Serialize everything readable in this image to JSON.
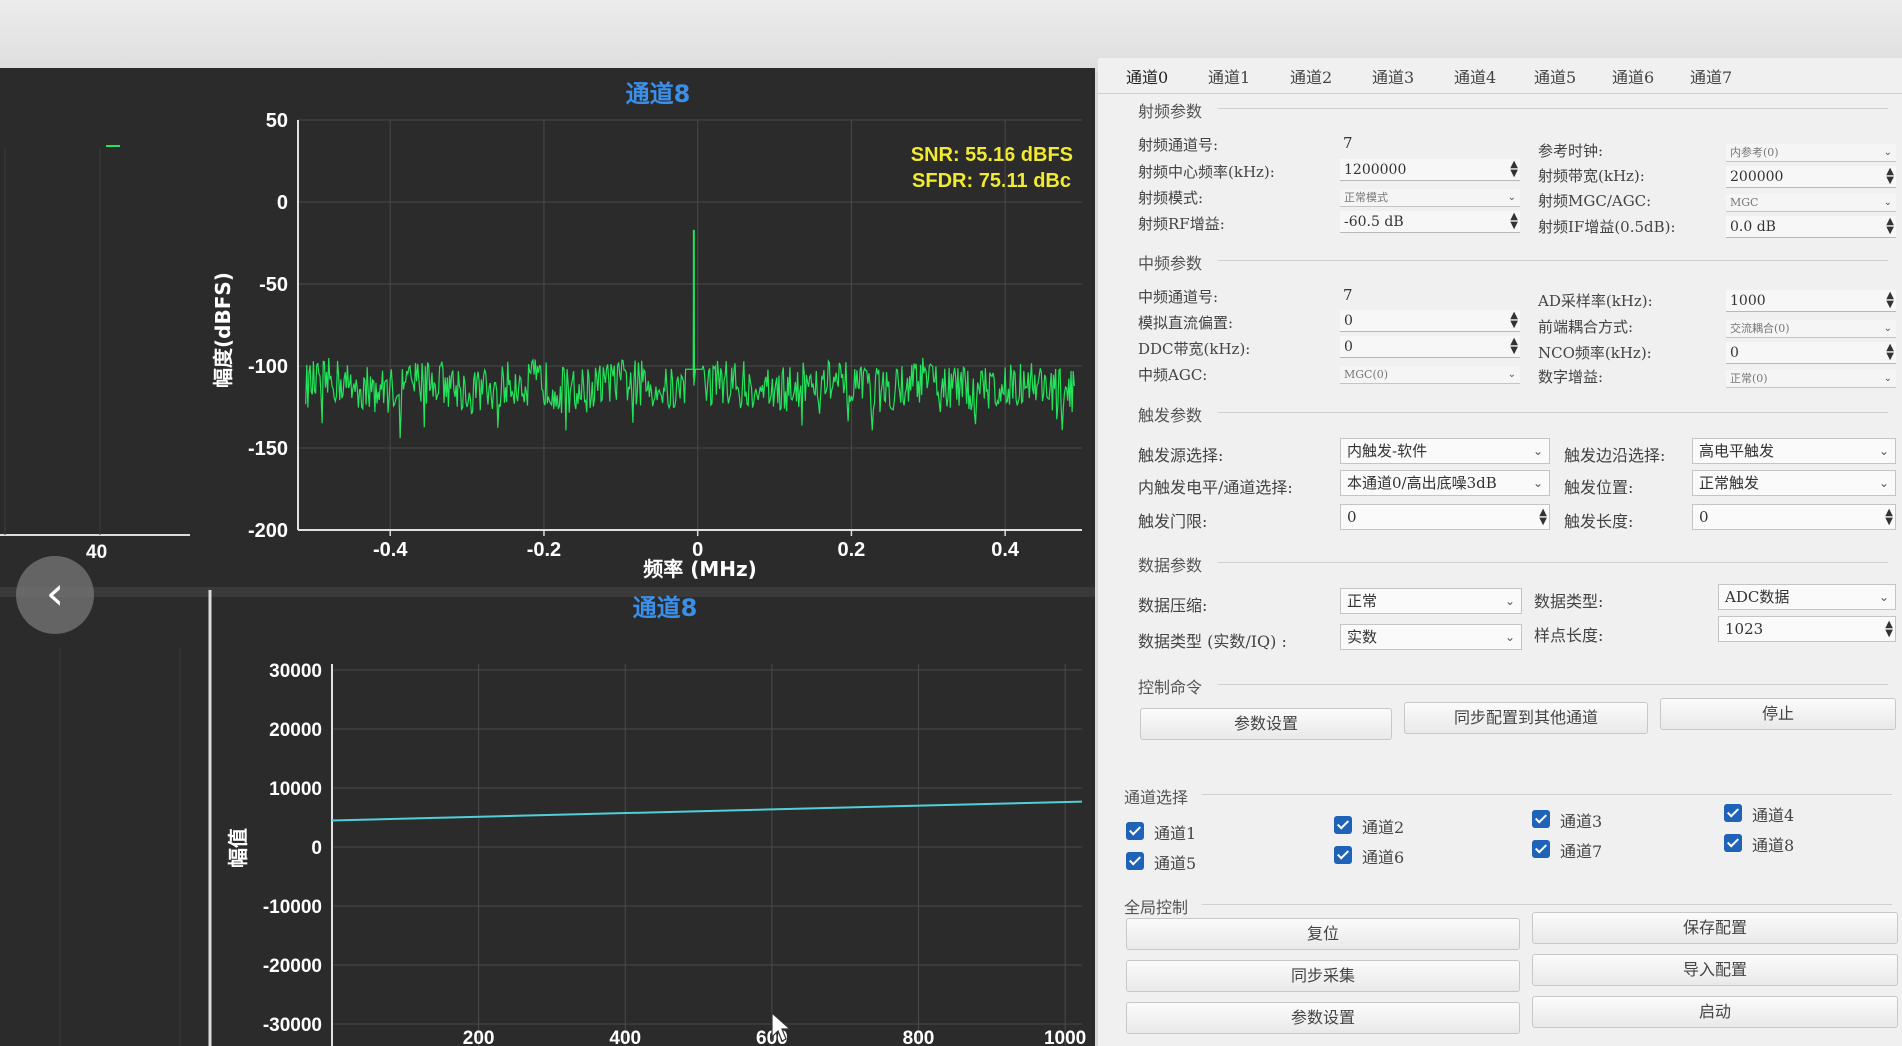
{
  "spectrum": {
    "title": "通道8",
    "snr": "SNR: 55.16 dBFS",
    "sfdr": "SFDR: 75.11 dBc",
    "ylabel": "幅度(dBFS)",
    "xlabel": "频率 (MHz)",
    "yticks": [
      "50",
      "0",
      "-50",
      "-100",
      "-150",
      "-200"
    ],
    "xticks": [
      "-0.4",
      "-0.2",
      "0",
      "0.2",
      "0.4"
    ],
    "trace_color": "#22e35a"
  },
  "left_partial": {
    "xtick": "40",
    "legend_color": "#22e35a"
  },
  "timedomain": {
    "title": "通道8",
    "ylabel": "幅值",
    "yticks": [
      "30000",
      "20000",
      "10000",
      "0",
      "-10000",
      "-20000",
      "-30000"
    ],
    "xticks": [
      "200",
      "400",
      "600",
      "800",
      "1000"
    ],
    "trace_color": "#4fd0d8"
  },
  "chart_data": [
    {
      "type": "line",
      "title": "通道8",
      "xlabel": "频率 (MHz)",
      "ylabel": "幅度(dBFS)",
      "xlim": [
        -0.52,
        0.5
      ],
      "ylim": [
        -200,
        50
      ],
      "grid": true,
      "annotations": [
        "SNR: 55.16 dBFS",
        "SFDR: 75.11 dBc"
      ],
      "series": [
        {
          "noise_floor": -112,
          "peak": {
            "x": -0.005,
            "y": -17
          },
          "x_range": [
            -0.51,
            0.49
          ]
        }
      ]
    },
    {
      "type": "line",
      "title": "通道8",
      "xlabel": "",
      "ylabel": "幅值",
      "xlim": [
        0,
        1023
      ],
      "ylim": [
        -30000,
        30000
      ],
      "grid": true,
      "series": [
        {
          "x": [
            0,
            1023
          ],
          "y": [
            4500,
            7700
          ]
        }
      ]
    }
  ],
  "tabs": [
    "通道0",
    "通道1",
    "通道2",
    "通道3",
    "通道4",
    "通道5",
    "通道6",
    "通道7"
  ],
  "rf": {
    "title": "射频参数",
    "channel_label": "射频通道号:",
    "channel_value": "7",
    "center_freq_label": "射频中心频率(kHz):",
    "center_freq_value": "1200000",
    "mode_label": "射频模式:",
    "mode_value": "正常模式",
    "rf_gain_label": "射频RF增益:",
    "rf_gain_value": "-60.5  dB",
    "ref_clock_label": "参考时钟:",
    "ref_clock_value": "内参考(0)",
    "bandwidth_label": "射频带宽(kHz):",
    "bandwidth_value": "200000",
    "mgc_agc_label": "射频MGC/AGC:",
    "mgc_agc_value": "MGC",
    "if_gain_label": "射频IF增益(0.5dB):",
    "if_gain_value": "0.0  dB"
  },
  "if": {
    "title": "中频参数",
    "channel_label": "中频通道号:",
    "channel_value": "7",
    "dc_bias_label": "模拟直流偏置:",
    "dc_bias_value": "0",
    "ddc_bw_label": "DDC带宽(kHz):",
    "ddc_bw_value": "0",
    "agc_label": "中频AGC:",
    "agc_value": "MGC(0)",
    "ad_rate_label": "AD采样率(kHz):",
    "ad_rate_value": "1000",
    "coupling_label": "前端耦合方式:",
    "coupling_value": "交流耦合(0)",
    "nco_label": "NCO频率(kHz):",
    "nco_value": "0",
    "digital_gain_label": "数字增益:",
    "digital_gain_value": "正常(0)"
  },
  "trigger": {
    "title": "触发参数",
    "source_label": "触发源选择:",
    "source_value": "内触发-软件",
    "level_label": "内触发电平/通道选择:",
    "level_value": "本通道0/高出底噪3dB",
    "threshold_label": "触发门限:",
    "threshold_value": "0",
    "edge_label": "触发边沿选择:",
    "edge_value": "高电平触发",
    "position_label": "触发位置:",
    "position_value": "正常触发",
    "length_label": "触发长度:",
    "length_value": "0"
  },
  "data": {
    "title": "数据参数",
    "compress_label": "数据压缩:",
    "compress_value": "正常",
    "datatype_label": "数据类型 (实数/IQ) :",
    "datatype_value": "实数",
    "type_label": "数据类型:",
    "type_value": "ADC数据",
    "sample_len_label": "样点长度:",
    "sample_len_value": "1023"
  },
  "control": {
    "title": "控制命令",
    "set_params": "参数设置",
    "sync_config": "同步配置到其他通道",
    "stop": "停止"
  },
  "channel_select": {
    "title": "通道选择",
    "items": [
      "通道1",
      "通道2",
      "通道3",
      "通道4",
      "通道5",
      "通道6",
      "通道7",
      "通道8"
    ]
  },
  "global": {
    "title": "全局控制",
    "reset": "复位",
    "save_config": "保存配置",
    "sync_capture": "同步采集",
    "import_config": "导入配置",
    "set_params": "参数设置",
    "start": "启动"
  }
}
